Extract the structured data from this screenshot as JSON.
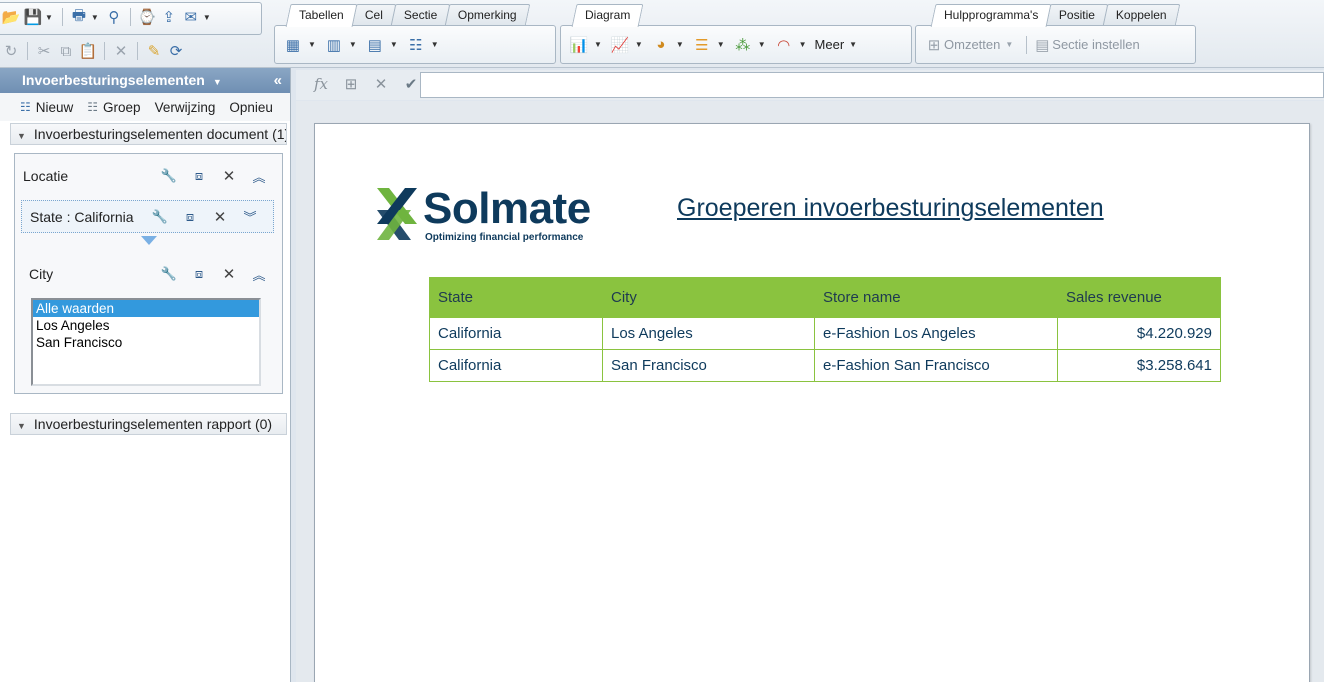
{
  "ribbon": {
    "groups": [
      {
        "tabs": [
          "Tabellen",
          "Cel",
          "Sectie",
          "Opmerking"
        ],
        "active": 0
      },
      {
        "tabs": [
          "Diagram"
        ],
        "active": 0,
        "more_label": "Meer"
      },
      {
        "tabs": [
          "Hulpprogramma's",
          "Positie",
          "Koppelen"
        ],
        "active": 0,
        "convert_label": "Omzetten",
        "section_label": "Sectie instellen"
      }
    ]
  },
  "left_panel": {
    "title": "Invoerbesturingselementen",
    "tools": {
      "new": "Nieuw",
      "group": "Groep",
      "reference": "Verwijzing",
      "reset": "Opnieu"
    },
    "document_section": "Invoerbesturingselementen document (1)",
    "report_section": "Invoerbesturingselementen rapport (0)",
    "group_name": "Locatie",
    "state_control": "State : California",
    "city_control": "City",
    "city_options": [
      "Alle waarden",
      "Los Angeles",
      "San Francisco"
    ],
    "city_selected": 0
  },
  "report": {
    "logo_name": "Solmate",
    "logo_tagline": "Optimizing financial performance",
    "title": "Groeperen invoerbesturingselementen",
    "columns": [
      "State",
      "City",
      "Store name",
      "Sales revenue"
    ],
    "rows": [
      [
        "California",
        "Los Angeles",
        "e-Fashion Los Angeles",
        "$4.220.929"
      ],
      [
        "California",
        "San Francisco",
        "e-Fashion San Francisco",
        "$3.258.641"
      ]
    ],
    "colors": {
      "header_green": "#8ac33f",
      "title_navy": "#0e3a5c",
      "logo_green": "#6fb43f"
    }
  }
}
